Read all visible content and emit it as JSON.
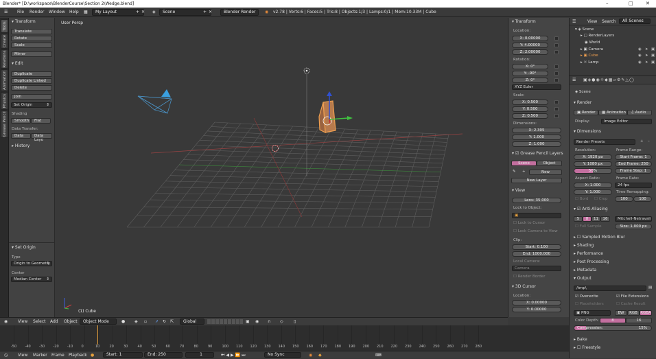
{
  "window": {
    "title": "Blender* [D:\\workspace\\BlenderCourse\\Section 2\\Wedge.blend]"
  },
  "info_header": {
    "menus": [
      "File",
      "Render",
      "Window",
      "Help"
    ],
    "layout": "My Layout",
    "scene": "Scene",
    "engine": "Blender Render",
    "stats": "v2.78 | Verts:6 | Faces:5 | Tris:8 | Objects:1/3 | Lamps:0/1 | Mem:10.33M | Cube"
  },
  "side_tabs": [
    "Tools",
    "Create",
    "Relations",
    "Animation",
    "Physics",
    "Grease Pencil"
  ],
  "tool_shelf": {
    "transform": {
      "title": "Transform",
      "buttons": [
        "Translate",
        "Rotate",
        "Scale",
        "Mirror"
      ]
    },
    "edit": {
      "title": "Edit",
      "buttons": [
        "Duplicate",
        "Duplicate Linked",
        "Delete",
        "Join"
      ],
      "set_origin": "Set Origin"
    },
    "shading": {
      "label": "Shading",
      "smooth": "Smooth",
      "flat": "Flat"
    },
    "data_transfer": {
      "label": "Data Transfer:",
      "data": "Data",
      "data_layout": "Data Layo"
    },
    "history": "History",
    "operator": {
      "title": "Set Origin",
      "type_label": "Type",
      "type_value": "Origin to Geometry",
      "center_label": "Center",
      "center_value": "Median Center"
    }
  },
  "viewport": {
    "label": "User Persp",
    "object_label": "(1) Cube"
  },
  "viewport_header": {
    "menus": [
      "View",
      "Select",
      "Add",
      "Object"
    ],
    "mode": "Object Mode",
    "orientation": "Global"
  },
  "n_panel": {
    "transform_title": "Transform",
    "location": {
      "label": "Location:",
      "x": "0.00000",
      "y": "4.00000",
      "z": "2.00000"
    },
    "rotation": {
      "label": "Rotation:",
      "x": "0°",
      "y": "-90°",
      "z": "0°",
      "mode": "XYZ Euler"
    },
    "scale": {
      "label": "Scale:",
      "x": "0.500",
      "y": "0.500",
      "z": "0.500"
    },
    "dimensions": {
      "label": "Dimensions:",
      "x": "2.305",
      "y": "1.000",
      "z": "1.000"
    },
    "grease_pencil": {
      "title": "Grease Pencil Layers",
      "scene": "Scene",
      "object": "Object",
      "new": "New",
      "new_layer": "New Layer"
    },
    "view": {
      "title": "View",
      "lens_label": "Lens:",
      "lens": "35.000",
      "lock_object": "Lock to Object:",
      "lock_cursor": "Lock to Cursor",
      "lock_camera": "Lock Camera to View",
      "clip": "Clip:",
      "start_label": "Start:",
      "start": "0.100",
      "end_label": "End:",
      "end": "1000.000",
      "local_camera": "Local Camera:",
      "camera": "Camera",
      "render_border": "Render Border"
    },
    "cursor": {
      "title": "3D Cursor",
      "location": "Location:",
      "x": "0.00000",
      "y": "0.00000"
    }
  },
  "outliner": {
    "menus": [
      "View",
      "Search",
      "All Scenes"
    ],
    "items": [
      "Scene",
      "RenderLayers",
      "World",
      "Camera",
      "Cube",
      "Lamp"
    ]
  },
  "properties": {
    "context": "Scene",
    "render_title": "Render",
    "render_buttons": [
      "Render",
      "Animation",
      "Audio"
    ],
    "display_label": "Display:",
    "display_value": "Image Editor",
    "dimensions_title": "Dimensions",
    "render_presets": "Render Presets",
    "resolution_label": "Resolution:",
    "res_x": "1920 px",
    "res_y": "1080 px",
    "res_pct": "50%",
    "frame_range_label": "Frame Range:",
    "start_frame": "1",
    "end_frame": "250",
    "frame_step": "1",
    "aspect_label": "Aspect Ratio:",
    "aspect_x": "1.000",
    "aspect_y": "1.000",
    "frame_rate_label": "Frame Rate:",
    "frame_rate": "24 fps",
    "time_remap_label": "Time Remapping:",
    "remap_old": "100",
    "remap_new": "100",
    "border": "Bord",
    "crop": "Crop",
    "aa_title": "Anti-Aliasing",
    "aa_samples": [
      "5",
      "8",
      "11",
      "16"
    ],
    "aa_filter": "Mitchell-Netravali",
    "full_sample": "Full Sample",
    "aa_size": "1.000 px",
    "size_label": "Size:",
    "panels": [
      "Sampled Motion Blur",
      "Shading",
      "Performance",
      "Post Processing",
      "Metadata"
    ],
    "output_title": "Output",
    "output_path": "/tmp\\",
    "overwrite": "Overwrite",
    "file_extensions": "File Extensions",
    "placeholders": "Placeholders",
    "cache_result": "Cache Result",
    "format": "PNG",
    "color_modes": [
      "BW",
      "RGB",
      "RGBA"
    ],
    "color_depth_label": "Color Depth:",
    "depth_values": [
      "8",
      "16"
    ],
    "compression_label": "Compression:",
    "compression": "15%",
    "bake": "Bake",
    "freestyle": "Freestyle"
  },
  "timeline": {
    "ticks": [
      "-50",
      "-40",
      "-30",
      "-20",
      "-10",
      "0",
      "10",
      "20",
      "30",
      "40",
      "50",
      "60",
      "70",
      "80",
      "90",
      "100",
      "110",
      "120",
      "130",
      "140",
      "150",
      "160",
      "170",
      "180",
      "190",
      "200",
      "210",
      "220",
      "230",
      "240",
      "250",
      "260",
      "270",
      "280"
    ],
    "current_frame": "1"
  },
  "timeline_header": {
    "menus": [
      "View",
      "Marker",
      "Frame",
      "Playback"
    ],
    "start_label": "Start:",
    "start": "1",
    "end_label": "End:",
    "end": "250",
    "frame": "1",
    "sync": "No Sync"
  },
  "colors": {
    "selected_orange": "#f0a050",
    "grid_x": "#c05050",
    "grid_y": "#60c060",
    "accent_pink": "#c36f9f"
  }
}
